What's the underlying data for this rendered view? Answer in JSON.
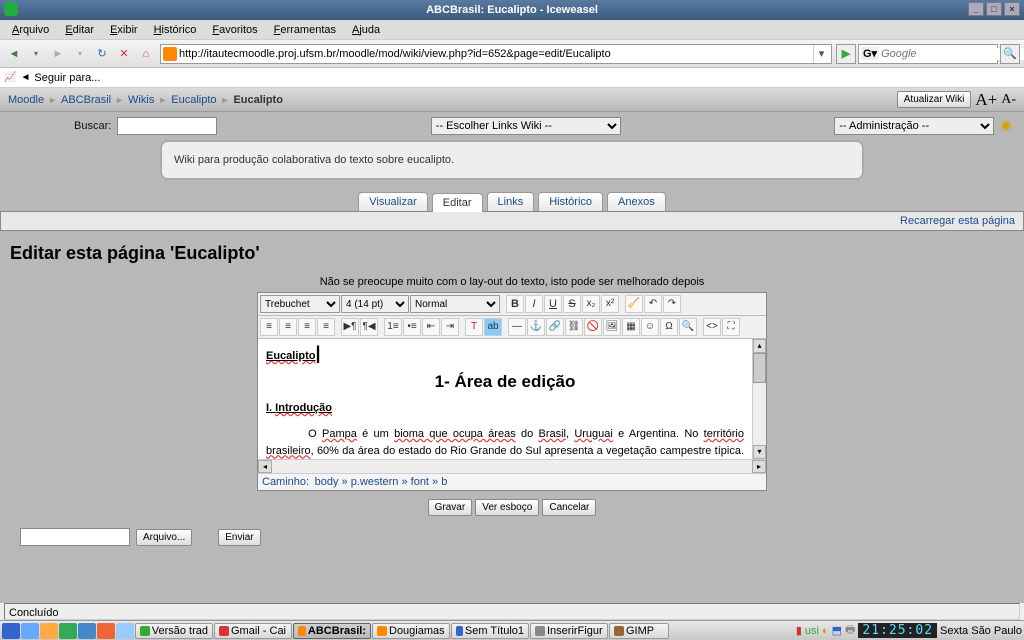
{
  "window": {
    "title": "ABCBrasil: Eucalipto - Iceweasel"
  },
  "menu": [
    "Arquivo",
    "Editar",
    "Exibir",
    "Histórico",
    "Favoritos",
    "Ferramentas",
    "Ajuda"
  ],
  "url": "http://itautecmoodle.proj.ufsm.br/moodle/mod/wiki/view.php?id=652&page=edit/Eucalipto",
  "search": {
    "placeholder": "Google"
  },
  "subbar": {
    "label": "Seguir para..."
  },
  "breadcrumb": {
    "items": [
      "Moodle",
      "ABCBrasil",
      "Wikis",
      "Eucalipto"
    ],
    "current": "Eucalipto",
    "update": "Atualizar Wiki",
    "aplus": "A+",
    "aminus": "A-"
  },
  "controls": {
    "search_label": "Buscar:",
    "wiki_sel": "-- Escolher Links Wiki --",
    "admin_sel": "-- Administração --"
  },
  "info": "Wiki para produção colaborativa do texto sobre eucalipto.",
  "tabs": [
    "Visualizar",
    "Editar",
    "Links",
    "Histórico",
    "Anexos"
  ],
  "reload": "Recarregar esta página",
  "heading": "Editar esta página 'Eucalipto'",
  "hint": "Não se preocupe muito com o lay-out do texto, isto pode ser melhorado depois",
  "editor": {
    "font_sel": "Trebuchet",
    "size_sel": "4 (14 pt)",
    "style_sel": "Normal",
    "title": "Eucalipto",
    "center": "1- Área de edição",
    "sec": "I. Introdução",
    "body": "O Pampa é um bioma que ocupa áreas do Brasil, Uruguai e Argentina. No território brasileiro, 60% da área do estado do Rio Grande do Sul apresenta a vegetação campestre típica. Do espaço total",
    "path_label": "Caminho:",
    "path": "body » p.western » font » b"
  },
  "buttons": {
    "save": "Gravar",
    "preview": "Ver esboço",
    "cancel": "Cancelar",
    "file": "Arquivo...",
    "send": "Enviar"
  },
  "status": "Concluído",
  "tasks": [
    "Versão trad",
    "Gmail - Cai",
    "ABCBrasil:",
    "Dougiamas",
    "Sem Título1",
    "InserirFigur",
    "GIMP"
  ],
  "clock": "21:25:02",
  "date": "Sexta São Paulo"
}
